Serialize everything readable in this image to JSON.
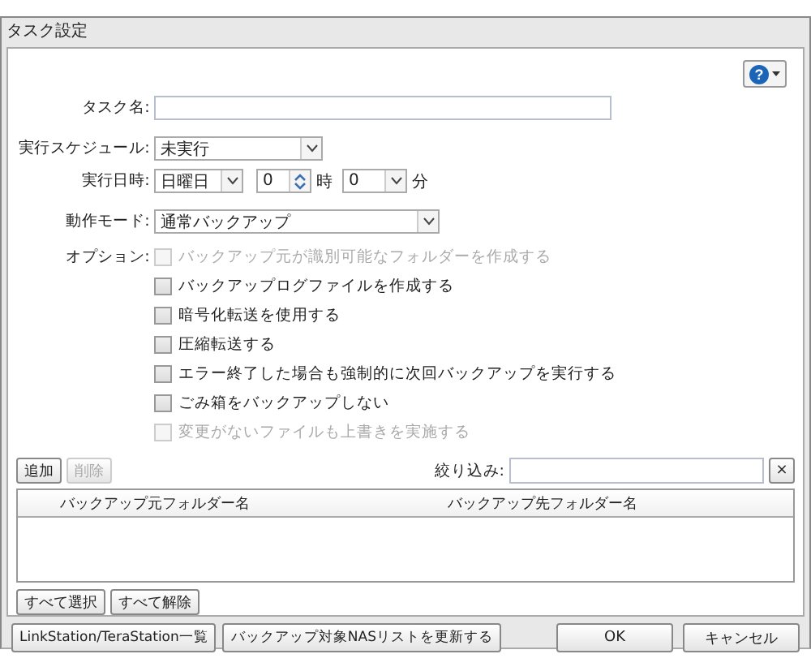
{
  "window": {
    "title": "タスク設定"
  },
  "help_button": {
    "label": "?"
  },
  "form": {
    "task_name": {
      "label": "タスク名:"
    },
    "schedule": {
      "label": "実行スケジュール:",
      "value": "未実行"
    },
    "datetime": {
      "label": "実行日時:",
      "day": "日曜日",
      "hour": "0",
      "hour_unit": "時",
      "minute": "0",
      "minute_unit": "分"
    },
    "mode": {
      "label": "動作モード:",
      "value": "通常バックアップ"
    },
    "options_label": "オプション:",
    "options": [
      {
        "label": "バックアップ元が識別可能なフォルダーを作成する",
        "checked": false,
        "disabled": true
      },
      {
        "label": "バックアップログファイルを作成する",
        "checked": false,
        "disabled": false
      },
      {
        "label": "暗号化転送を使用する",
        "checked": false,
        "disabled": false
      },
      {
        "label": "圧縮転送する",
        "checked": false,
        "disabled": false
      },
      {
        "label": "エラー終了した場合も強制的に次回バックアップを実行する",
        "checked": false,
        "disabled": false
      },
      {
        "label": "ごみ箱をバックアップしない",
        "checked": false,
        "disabled": false
      },
      {
        "label": "変更がないファイルも上書きを実施する",
        "checked": false,
        "disabled": true
      }
    ]
  },
  "list_toolbar": {
    "buttons": [
      {
        "label": "追加",
        "disabled": false
      },
      {
        "label": "削除",
        "disabled": true
      }
    ],
    "filter": {
      "label": "絞り込み:",
      "clear": "×"
    }
  },
  "table": {
    "columns": [
      "バックアップ元フォルダー名",
      "バックアップ先フォルダー名"
    ]
  },
  "selection_buttons": [
    "すべて選択",
    "すべて解除"
  ],
  "footer": {
    "left_buttons": [
      "LinkStation/TeraStation一覧",
      "バックアップ対象NASリストを更新する"
    ],
    "right_buttons": [
      "OK",
      "キャンセル"
    ]
  }
}
